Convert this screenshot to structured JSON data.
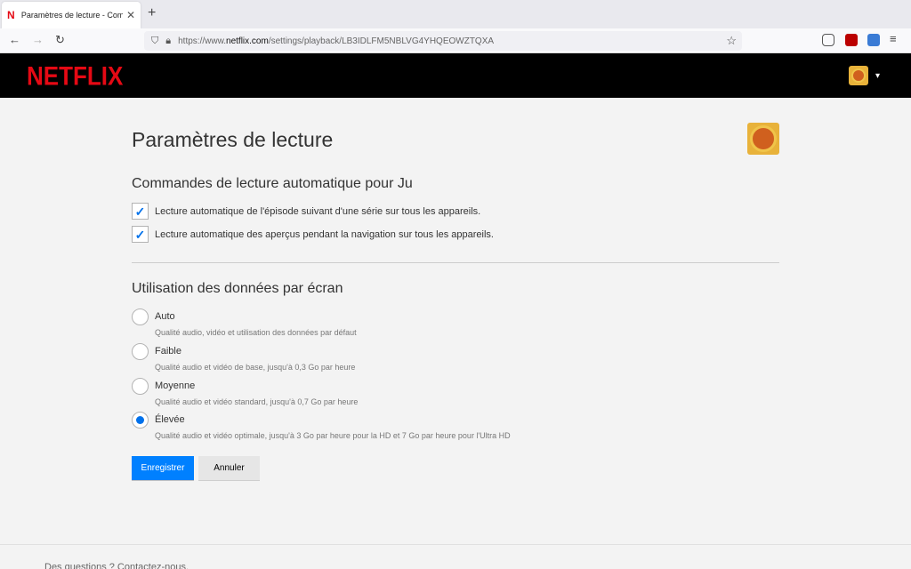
{
  "browser": {
    "tab_title": "Paramètres de lecture - Compte",
    "tab_favicon": "N",
    "url_prefix": "https://www.",
    "url_domain": "netflix.com",
    "url_path": "/settings/playback/LB3IDLFM5NBLVG4YHQEOWZTQXA",
    "new_tab": "+",
    "close_tab": "✕"
  },
  "header": {
    "logo": "NETFLIX",
    "caret": "▾"
  },
  "page": {
    "title": "Paramètres de lecture"
  },
  "autoplay": {
    "section_title": "Commandes de lecture automatique pour Ju",
    "options": [
      {
        "label": "Lecture automatique de l'épisode suivant d'une série sur tous les appareils.",
        "checked": true
      },
      {
        "label": "Lecture automatique des aperçus pendant la navigation sur tous les appareils.",
        "checked": true
      }
    ]
  },
  "data_usage": {
    "section_title": "Utilisation des données par écran",
    "options": [
      {
        "label": "Auto",
        "description": "Qualité audio, vidéo et utilisation des données par défaut",
        "selected": false
      },
      {
        "label": "Faible",
        "description": "Qualité audio et vidéo de base, jusqu'à 0,3 Go par heure",
        "selected": false
      },
      {
        "label": "Moyenne",
        "description": "Qualité audio et vidéo standard, jusqu'à 0,7 Go par heure",
        "selected": false
      },
      {
        "label": "Élevée",
        "description": "Qualité audio et vidéo optimale, jusqu'à 3 Go par heure pour la HD et 7 Go par heure pour l'Ultra HD",
        "selected": true
      }
    ]
  },
  "buttons": {
    "save": "Enregistrer",
    "cancel": "Annuler"
  },
  "footer": {
    "text": "Des questions ? Contactez-nous."
  },
  "colors": {
    "netflix_red": "#e50914",
    "accent_blue": "#0071eb",
    "save_button": "#0080ff"
  }
}
